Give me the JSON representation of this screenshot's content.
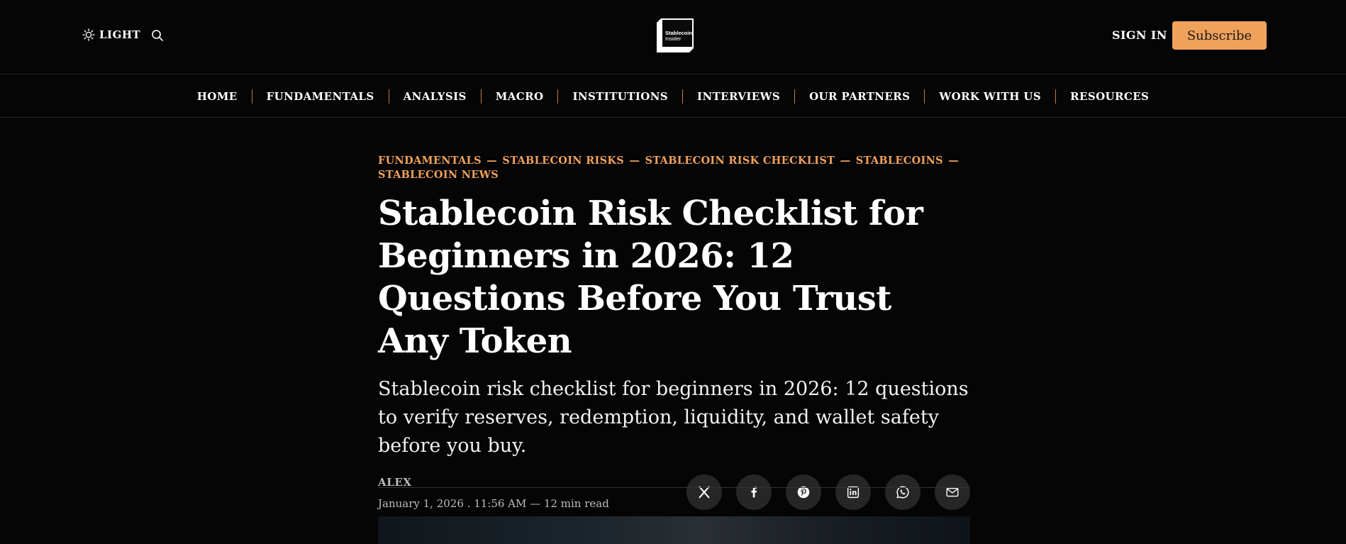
{
  "header": {
    "theme_label": "LIGHT",
    "logo_text": [
      "Stablecoin",
      "Insider"
    ],
    "signin_label": "SIGN IN",
    "subscribe_label": "Subscribe",
    "accent": "#f0a15b"
  },
  "nav": {
    "items": [
      {
        "label": "HOME"
      },
      {
        "label": "FUNDAMENTALS"
      },
      {
        "label": "ANALYSIS"
      },
      {
        "label": "MACRO"
      },
      {
        "label": "INSTITUTIONS"
      },
      {
        "label": "INTERVIEWS"
      },
      {
        "label": "OUR PARTNERS"
      },
      {
        "label": "WORK WITH US"
      },
      {
        "label": "RESOURCES"
      }
    ]
  },
  "article": {
    "tags": [
      "FUNDAMENTALS",
      "STABLECOIN RISKS",
      "STABLECOIN RISK CHECKLIST",
      "STABLECOINS",
      "STABLECOIN NEWS"
    ],
    "tag_separator": "—",
    "title": "Stablecoin Risk Checklist for Beginners in 2026: 12 Questions Before You Trust Any Token",
    "subtitle": "Stablecoin risk checklist for beginners in 2026: 12 questions to verify reserves, redemption, liquidity, and wallet safety before you buy.",
    "author": "ALEX",
    "date_line": "January 1, 2026 . 11:56 AM — 12 min read",
    "share_icons": [
      "x-icon",
      "facebook-icon",
      "pinterest-icon",
      "linkedin-icon",
      "whatsapp-icon",
      "email-icon"
    ]
  }
}
